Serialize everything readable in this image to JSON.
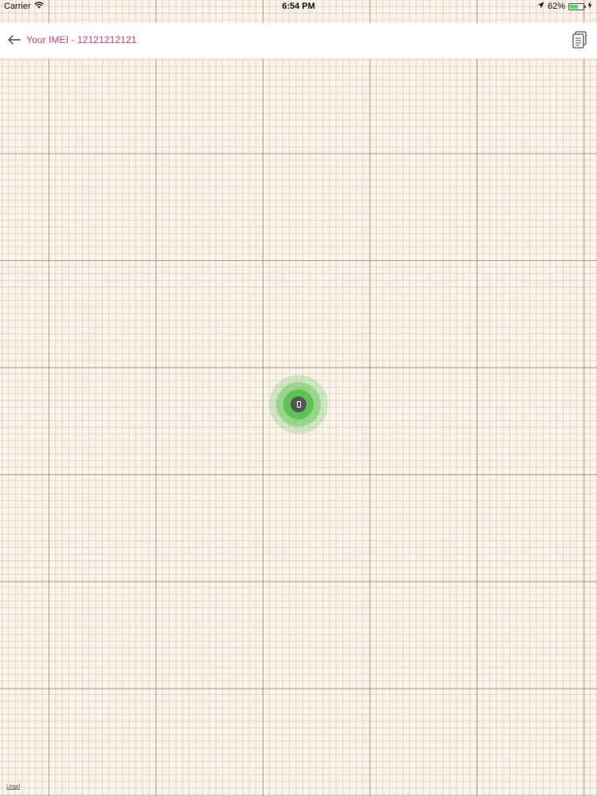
{
  "status_bar": {
    "carrier": "Carrier",
    "time": "6:54 PM",
    "battery_percent": "62%",
    "battery_level": 0.62,
    "icons": [
      "wifi-icon",
      "location-arrow-icon",
      "battery-icon",
      "charging-bolt-icon"
    ]
  },
  "nav": {
    "title": "Your IMEI - 12121212121",
    "back_icon": "back-arrow-icon",
    "action_icon": "document-icon",
    "title_color": "#d63a78"
  },
  "map": {
    "marker_icon": "phone-icon",
    "marker_color": "#5cc356",
    "legal_label": "Legal"
  }
}
